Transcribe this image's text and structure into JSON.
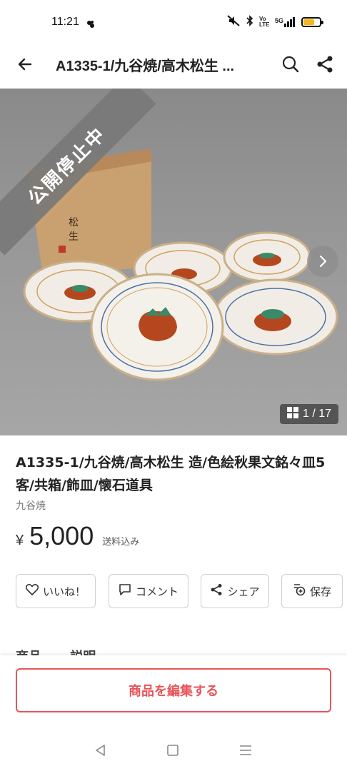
{
  "status_bar": {
    "time": "11:21",
    "network": "5G",
    "volte": "Vo LTE",
    "battery_level": 0.7,
    "battery_color": "#f5b61a"
  },
  "app_bar": {
    "back_icon": "arrow-left-icon",
    "title": "A1335-1/九谷焼/高木松生 ...",
    "search_icon": "search-icon",
    "share_icon": "share-icon"
  },
  "hero": {
    "ribbon_text": "公開停止中",
    "next_icon": "chevron-right-icon",
    "counter_icon": "grid-icon",
    "counter_text": "1 / 17"
  },
  "product": {
    "title": "A1335-1/九谷焼/高木松生 造/色絵秋果文銘々皿5客/共箱/飾皿/懐石道具",
    "brand": "九谷焼",
    "currency": "¥",
    "price": "5,000",
    "shipping": "送料込み"
  },
  "actions": {
    "like": {
      "label": "いいね！",
      "icon": "heart-icon"
    },
    "comment": {
      "label": "コメント",
      "icon": "comment-icon"
    },
    "share": {
      "label": "シェア",
      "icon": "share-icon"
    },
    "save": {
      "label": "保存",
      "icon": "save-icon"
    }
  },
  "tabs_peek": [
    "商品",
    "説明"
  ],
  "bottom": {
    "edit_button": "商品を編集する",
    "accent_color": "#e8545a"
  },
  "nav_bar": {
    "back_icon": "triangle-back-icon",
    "home_icon": "square-home-icon",
    "menu_icon": "menu-lines-icon"
  }
}
